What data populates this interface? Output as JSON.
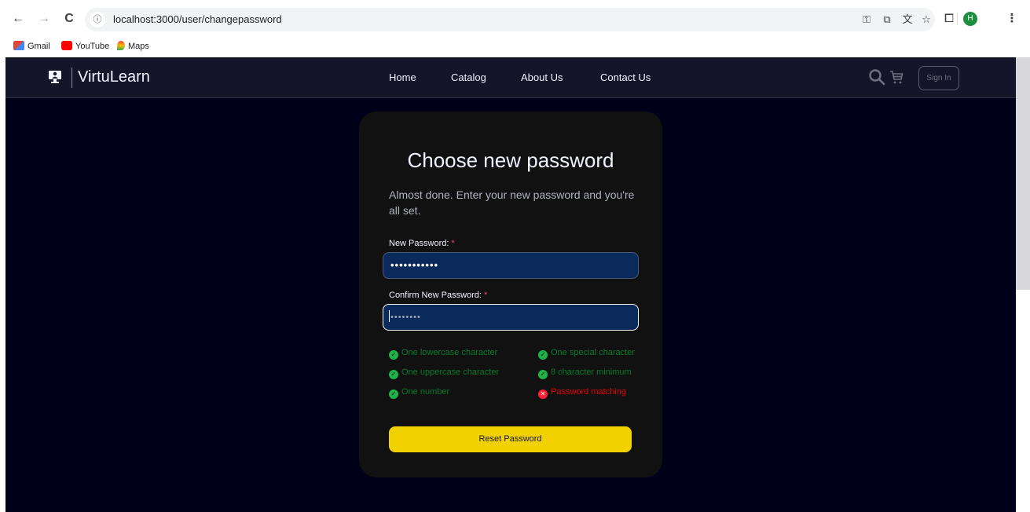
{
  "browser": {
    "url": "localhost:3000/user/changepassword",
    "profile_initial": "H",
    "bookmarks": [
      {
        "label": "Gmail"
      },
      {
        "label": "YouTube"
      },
      {
        "label": "Maps"
      }
    ]
  },
  "site": {
    "brand": "VirtuLearn",
    "nav": [
      "Home",
      "Catalog",
      "About Us",
      "Contact Us"
    ],
    "sign_in": "Sign In"
  },
  "form": {
    "title": "Choose new password",
    "description": "Almost done. Enter your new password and you're all set.",
    "new_password_label": "New Password:",
    "confirm_password_label": "Confirm New Password:",
    "required_mark": "*",
    "new_password_value": "•••••••••••",
    "confirm_password_value": "••••••••",
    "rules": [
      {
        "label": "One lowercase character",
        "met": true
      },
      {
        "label": "One special character",
        "met": true
      },
      {
        "label": "One uppercase character",
        "met": true
      },
      {
        "label": "8 character minimum",
        "met": true
      },
      {
        "label": "One number",
        "met": true
      },
      {
        "label": "Password matching",
        "met": false
      }
    ],
    "submit_label": "Reset Password"
  },
  "colors": {
    "page_bg": "#000119",
    "card_bg": "#111111",
    "accent": "#f2d100",
    "ok": "#20b14a",
    "error": "#ff1f36"
  }
}
